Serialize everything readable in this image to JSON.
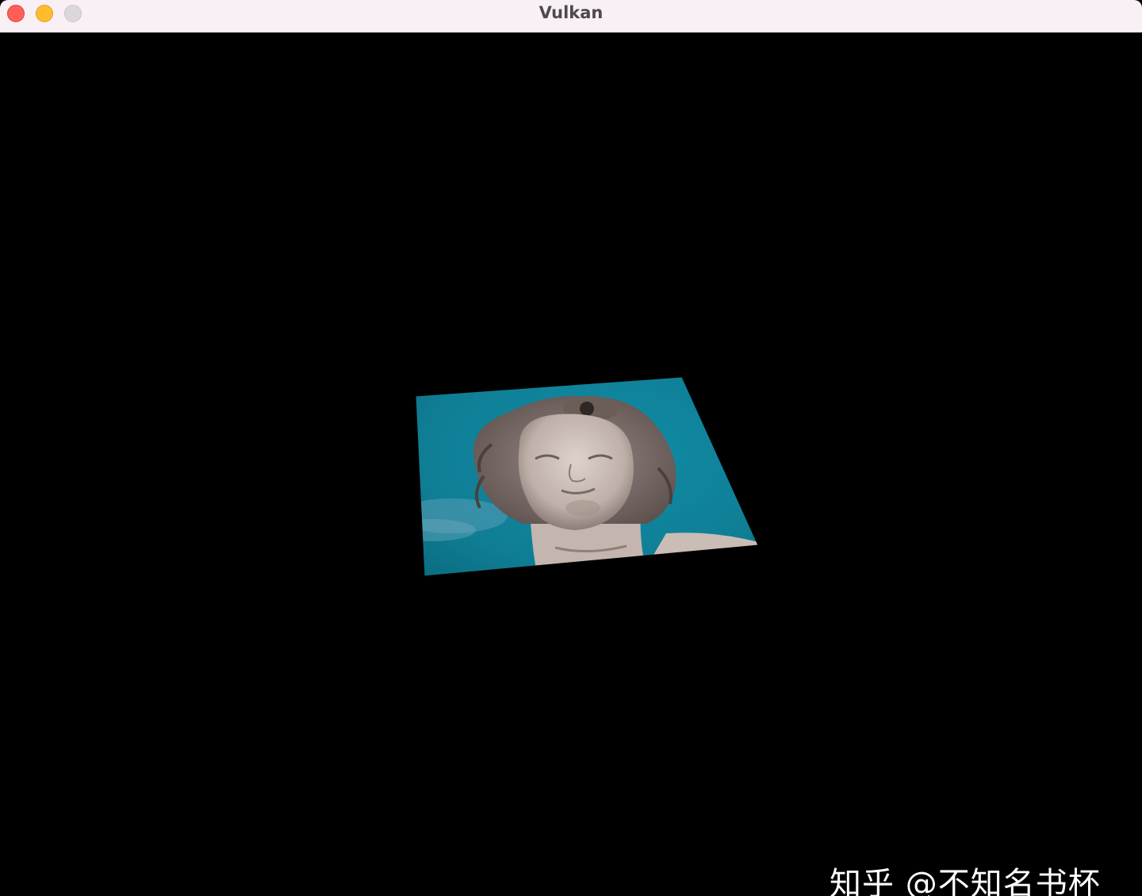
{
  "window": {
    "title": "Vulkan",
    "background_color": "#000000",
    "titlebar_color": "#f9f0f6",
    "buttons": [
      {
        "name": "close",
        "color": "#fe5f57"
      },
      {
        "name": "minimize",
        "color": "#febc2e"
      },
      {
        "name": "zoom",
        "color": "#dcd7db"
      }
    ]
  },
  "render": {
    "texture_subject": "statue-head-against-blue-sky",
    "sky_color": "#0f8097"
  },
  "watermark": {
    "text": "知乎 @不知名书杯"
  }
}
